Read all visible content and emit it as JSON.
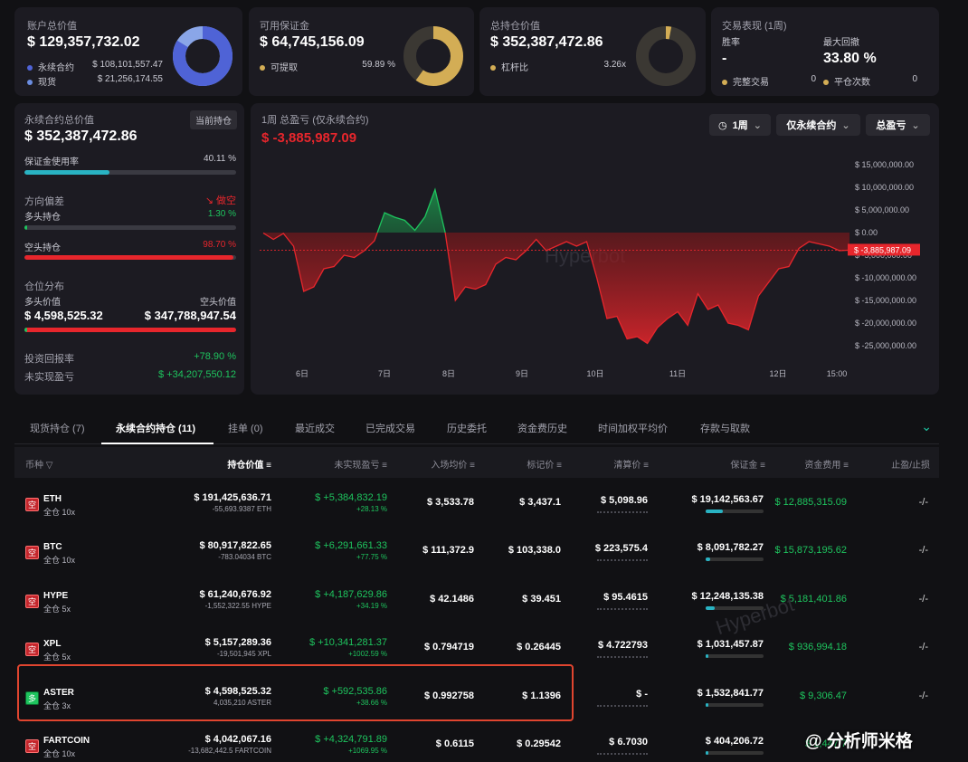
{
  "colors": {
    "green": "#1ec45e",
    "red": "#e7262c",
    "blue": "#4f63d6",
    "teal": "#29b3c3",
    "gold": "#d3ad55"
  },
  "summary": {
    "account": {
      "label": "账户总价值",
      "value": "$ 129,357,732.02",
      "rows": [
        {
          "label": "永续合约",
          "value": "$ 108,101,557.47"
        },
        {
          "label": "现货",
          "value": "$ 21,256,174.55"
        }
      ],
      "perp_share": 0.836
    },
    "margin": {
      "label": "可用保证金",
      "value": "$ 64,745,156.09",
      "row": {
        "label": "可提取",
        "value": "59.89 %"
      },
      "share": 0.5989
    },
    "position": {
      "label": "总持仓价值",
      "value": "$ 352,387,472.86",
      "row": {
        "label": "杠杆比",
        "value": "3.26x"
      },
      "share": 0.03
    },
    "perf": {
      "label": "交易表现 (1周)",
      "winrate_label": "胜率",
      "winrate_value": "-",
      "drawdown_label": "最大回撤",
      "drawdown_value": "33.80 %",
      "closed_label": "完整交易",
      "closed_value": "0",
      "flat_label": "平仓次数",
      "flat_value": "0"
    }
  },
  "perp_panel": {
    "title": "永续合约总价值",
    "badge": "当前持仓",
    "value": "$ 352,387,472.86",
    "margin_usage_label": "保证金使用率",
    "margin_usage_value": "40.11 %",
    "margin_usage": 0.4011,
    "bias_label": "方向偏差",
    "bias_value": "做空",
    "long_label": "多头持仓",
    "long_value": "1.30 %",
    "long_share": 0.013,
    "short_label": "空头持仓",
    "short_value": "98.70 %",
    "short_share": 0.987,
    "dist_label": "仓位分布",
    "long_val_label": "多头价值",
    "short_val_label": "空头价值",
    "long_val": "$ 4,598,525.32",
    "short_val": "$ 347,788,947.54",
    "roi_label": "投资回报率",
    "roi_value": "+78.90 %",
    "upnl_label": "未实现盈亏",
    "upnl_value": "$ +34,207,550.12"
  },
  "chart_panel": {
    "title": "1周 总盈亏 (仅永续合约)",
    "value": "$ -3,885,987.09",
    "controls": [
      "1周",
      "仅永续合约",
      "总盈亏"
    ],
    "current_label": "$ -3,885,987.09",
    "watermark": "Hyperbot"
  },
  "chart_data": {
    "type": "area",
    "x": [
      "6日",
      "7日",
      "8日",
      "9日",
      "10日",
      "11日",
      "12日",
      "15:00"
    ],
    "yticks": [
      "$ 15,000,000.00",
      "$ 10,000,000.00",
      "$ 5,000,000.00",
      "$ 0.00",
      "$ -5,000,000.00",
      "$ -10,000,000.00",
      "$ -15,000,000.00",
      "$ -20,000,000.00",
      "$ -25,000,000.00"
    ],
    "ylim": [
      -25000000,
      15000000
    ],
    "values": [
      -100000,
      -1500000,
      -200000,
      -3000000,
      -13000000,
      -12000000,
      -8000000,
      -7500000,
      -5000000,
      -5500000,
      -4000000,
      -1800000,
      4400000,
      3400000,
      2700000,
      500000,
      3500000,
      9500000,
      0,
      -15000000,
      -12000000,
      -12500000,
      -11500000,
      -7000000,
      -5500000,
      -6000000,
      -4000000,
      -1500000,
      -4000000,
      -3000000,
      -2000000,
      -3000000,
      -2000000,
      -10000000,
      -19000000,
      -18500000,
      -23500000,
      -23000000,
      -24500000,
      -21000000,
      -19000000,
      -17500000,
      -20500000,
      -13500000,
      -17000000,
      -16000000,
      -20000000,
      -20500000,
      -21500000,
      -14000000,
      -11000000,
      -8000000,
      -7500000,
      -3500000,
      -2000000,
      -2500000,
      -3000000,
      -4000000,
      -3885987
    ]
  },
  "tabs": [
    "现货持仓 (7)",
    "永续合约持仓 (11)",
    "挂单 (0)",
    "最近成交",
    "已完成交易",
    "历史委托",
    "资金费历史",
    "时间加权平均价",
    "存款与取款"
  ],
  "table": {
    "headers": [
      "币种",
      "持仓价值",
      "未实现盈亏",
      "入场均价",
      "标记价",
      "清算价",
      "保证金",
      "资金费用",
      "止盈/止损"
    ],
    "rows": [
      {
        "side": "空",
        "sym": "ETH",
        "mode": "全仓 10x",
        "value": "$ 191,425,636.71",
        "qty": "-55,693.9387 ETH",
        "pnl": "$ +5,384,832.19",
        "pnl_pct": "+28.13 %",
        "entry": "$ 3,533.78",
        "mark": "$ 3,437.1",
        "liq": "$ 5,098.96",
        "margin": "$ 19,142,563.67",
        "margin_fill": 0.3,
        "funding": "$ 12,885,315.09",
        "tpsl": "-/-"
      },
      {
        "side": "空",
        "sym": "BTC",
        "mode": "全仓 10x",
        "value": "$ 80,917,822.65",
        "qty": "-783.04034 BTC",
        "pnl": "$ +6,291,661.33",
        "pnl_pct": "+77.75 %",
        "entry": "$ 111,372.9",
        "mark": "$ 103,338.0",
        "liq": "$ 223,575.4",
        "margin": "$ 8,091,782.27",
        "margin_fill": 0.08,
        "funding": "$ 15,873,195.62",
        "tpsl": "-/-"
      },
      {
        "side": "空",
        "sym": "HYPE",
        "mode": "全仓 5x",
        "value": "$ 61,240,676.92",
        "qty": "-1,552,322.55 HYPE",
        "pnl": "$ +4,187,629.86",
        "pnl_pct": "+34.19 %",
        "entry": "$ 42.1486",
        "mark": "$ 39.451",
        "liq": "$ 95.4615",
        "margin": "$ 12,248,135.38",
        "margin_fill": 0.15,
        "funding": "$ 5,181,401.86",
        "tpsl": "-/-"
      },
      {
        "side": "空",
        "sym": "XPL",
        "mode": "全仓 5x",
        "value": "$ 5,157,289.36",
        "qty": "-19,501,945 XPL",
        "pnl": "$ +10,341,281.37",
        "pnl_pct": "+1002.59 %",
        "entry": "$ 0.794719",
        "mark": "$ 0.26445",
        "liq": "$ 4.722793",
        "margin": "$ 1,031,457.87",
        "margin_fill": 0.05,
        "funding": "$ 936,994.18",
        "tpsl": "-/-"
      },
      {
        "side": "多",
        "sym": "ASTER",
        "mode": "全仓 3x",
        "value": "$ 4,598,525.32",
        "qty": "4,035,210 ASTER",
        "pnl": "$ +592,535.86",
        "pnl_pct": "+38.66 %",
        "entry": "$ 0.992758",
        "mark": "$ 1.1396",
        "liq": "$ -",
        "margin": "$ 1,532,841.77",
        "margin_fill": 0.05,
        "funding": "$ 9,306.47",
        "tpsl": "-/-"
      },
      {
        "side": "空",
        "sym": "FARTCOIN",
        "mode": "全仓 10x",
        "value": "$ 4,042,067.16",
        "qty": "-13,682,442.5 FARTCOIN",
        "pnl": "$ +4,324,791.89",
        "pnl_pct": "+1069.95 %",
        "entry": "$ 0.6115",
        "mark": "$ 0.29542",
        "liq": "$ 6.7030",
        "margin": "$ 404,206.72",
        "margin_fill": 0.05,
        "funding": "$ 1,447,7",
        "tpsl": ""
      }
    ]
  },
  "watermark_text": "@ 分析师米格",
  "table_watermark": "Hyperbot"
}
